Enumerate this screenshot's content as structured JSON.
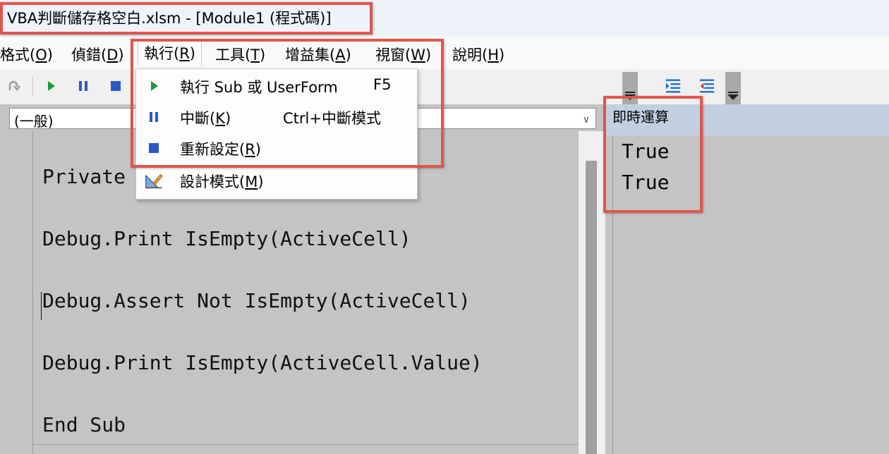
{
  "window": {
    "title": "VBA判斷儲存格空白.xlsm - [Module1 (程式碼)]"
  },
  "menubar": {
    "items": [
      {
        "id": "format",
        "label": "格式(O)"
      },
      {
        "id": "debug",
        "label": "偵錯(D)"
      },
      {
        "id": "run",
        "label": "執行(R)"
      },
      {
        "id": "tools",
        "label": "工具(T)"
      },
      {
        "id": "addins",
        "label": "增益集(A)"
      },
      {
        "id": "window",
        "label": "視窗(W)"
      },
      {
        "id": "help",
        "label": "說明(H)"
      }
    ]
  },
  "toolbar": {
    "icons": [
      "redo-icon",
      "run-icon",
      "break-icon",
      "reset-icon",
      "indent-icon",
      "outdent-icon"
    ]
  },
  "run_menu": {
    "items": [
      {
        "label": "執行 Sub 或 UserForm",
        "shortcut": "F5",
        "icon": "run-icon"
      },
      {
        "label": "中斷(K)",
        "shortcut": "Ctrl+中斷模式",
        "icon": "break-icon"
      },
      {
        "label": "重新設定(R)",
        "shortcut": "",
        "icon": "reset-icon"
      },
      {
        "label": "設計模式(M)",
        "shortcut": "",
        "icon": "design-mode-icon"
      }
    ]
  },
  "code_window": {
    "object_combo": "(一般)",
    "lines": [
      "Private S",
      "Debug.Print IsEmpty(ActiveCell)",
      "Debug.Assert Not IsEmpty(ActiveCell)",
      "Debug.Print IsEmpty(ActiveCell.Value)",
      "End Sub"
    ]
  },
  "immediate_window": {
    "title": "即時運算",
    "output": [
      "True",
      "True"
    ]
  },
  "colors": {
    "highlight": "#e0564c",
    "run_green": "#1e9b3a",
    "reset_blue": "#2b57c5",
    "code_background": "#c4c4c4"
  }
}
